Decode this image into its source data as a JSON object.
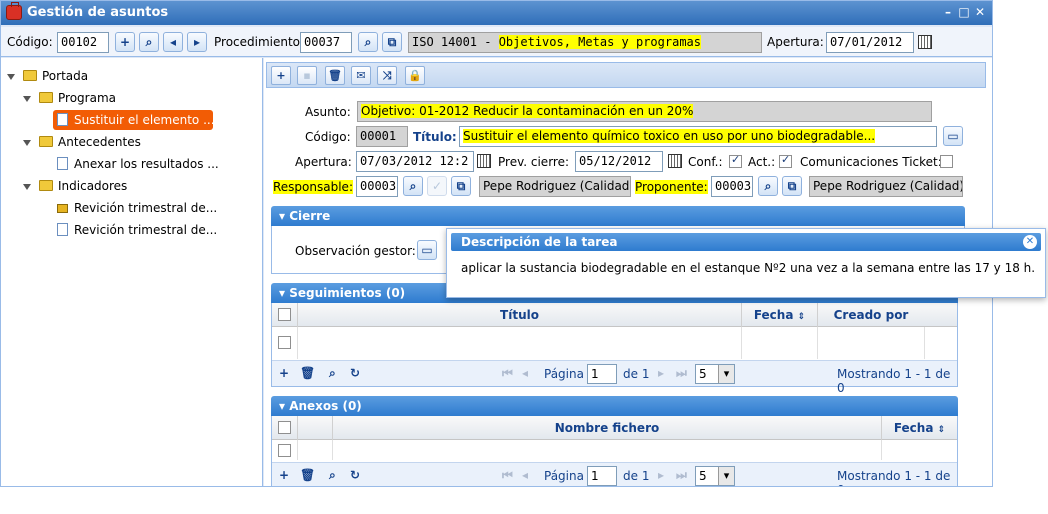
{
  "window": {
    "title": "Gestión de asuntos"
  },
  "topbar": {
    "codigo_label": "Código:",
    "codigo_value": "00102",
    "procedimiento_label": "Procedimiento",
    "procedimiento_value": "00037",
    "procedimiento_name_prefix": "ISO 14001 - ",
    "procedimiento_name_highlight": "Objetivos, Metas y programas",
    "apertura_label": "Apertura:",
    "apertura_value": "07/01/2012"
  },
  "tree": {
    "root": "Portada",
    "programa": "Programa",
    "programa_child": "Sustituir el elemento ...",
    "antecedentes": "Antecedentes",
    "antecedentes_child": "Anexar los resultados ...",
    "indicadores": "Indicadores",
    "indicadores_child1": "Revición trimestral de...",
    "indicadores_child2": "Revición trimestral de..."
  },
  "form": {
    "asunto_label": "Asunto:",
    "asunto_value": "Objetivo: 01-2012  Reducir la contaminación en un 20%",
    "codigo_label": "Código:",
    "codigo_value": "00001",
    "titulo_label": "Título:",
    "titulo_value": "Sustituir el elemento químico toxico en uso por uno biodegradable...",
    "apertura_label": "Apertura:",
    "apertura_value": "07/03/2012 12:2",
    "prev_cierre_label": "Prev. cierre:",
    "prev_cierre_value": "05/12/2012",
    "conf_label": "Conf.:",
    "act_label": "Act.:",
    "comunicaciones_label": "Comunicaciones Ticket:",
    "responsable_label": "Responsable:",
    "responsable_code": "00003",
    "responsable_name": "Pepe Rodriguez (Calidad)",
    "proponente_label": "Proponente:",
    "proponente_code": "00003",
    "proponente_name": "Pepe Rodriguez (Calidad)"
  },
  "cierre": {
    "title": "Cierre",
    "observacion_label": "Observación gestor:"
  },
  "popup": {
    "title": "Descripción de la tarea",
    "text": "aplicar la sustancia biodegradable en el estanque Nº2 una vez a la semana entre las 17 y 18 h."
  },
  "seguimientos": {
    "title": "Seguimientos (0)",
    "columns": [
      "Título",
      "Fecha",
      "Creado por"
    ],
    "pagina_label": "Página",
    "page": "1",
    "of_label": "de 1",
    "page_size": "5",
    "showing": "Mostrando 1 - 1 de 0"
  },
  "anexos": {
    "title": "Anexos (0)",
    "columns": [
      "Nombre fichero",
      "Fecha"
    ],
    "pagina_label": "Página",
    "page": "1",
    "of_label": "de 1",
    "page_size": "5",
    "showing": "Mostrando 1 - 1 de 0"
  },
  "icons": [
    "briefcase-icon",
    "add-icon",
    "search-icon",
    "prev-icon",
    "next-icon",
    "copy-icon",
    "calendar-icon",
    "folder-icon",
    "document-icon",
    "lock-icon",
    "save-icon",
    "delete-icon",
    "mail-icon",
    "shuffle-icon",
    "comment-icon",
    "refresh-icon",
    "close-icon"
  ],
  "colors": {
    "accent": "#2e7bcf",
    "selection": "#f25c05",
    "highlight": "#ffff00"
  }
}
